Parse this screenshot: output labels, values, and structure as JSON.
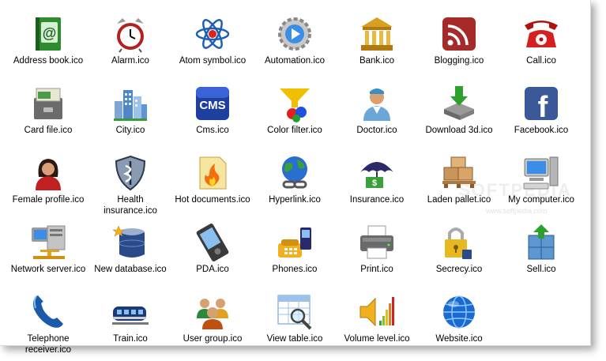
{
  "watermark": "SOFTPEDIA",
  "watermark_url": "www.softpedia.com",
  "icons": [
    {
      "label": "Address book.ico",
      "icon": "address-book-icon"
    },
    {
      "label": "Alarm.ico",
      "icon": "alarm-icon"
    },
    {
      "label": "Atom symbol.ico",
      "icon": "atom-icon"
    },
    {
      "label": "Automation.ico",
      "icon": "automation-icon"
    },
    {
      "label": "Bank.ico",
      "icon": "bank-icon"
    },
    {
      "label": "Blogging.ico",
      "icon": "blogging-icon"
    },
    {
      "label": "Call.ico",
      "icon": "call-icon"
    },
    {
      "label": "Card file.ico",
      "icon": "card-file-icon"
    },
    {
      "label": "City.ico",
      "icon": "city-icon"
    },
    {
      "label": "Cms.ico",
      "icon": "cms-icon",
      "text": "CMS"
    },
    {
      "label": "Color filter.ico",
      "icon": "color-filter-icon"
    },
    {
      "label": "Doctor.ico",
      "icon": "doctor-icon"
    },
    {
      "label": "Download 3d.ico",
      "icon": "download-3d-icon"
    },
    {
      "label": "Facebook.ico",
      "icon": "facebook-icon",
      "text": "f"
    },
    {
      "label": "Female profile.ico",
      "icon": "female-profile-icon"
    },
    {
      "label": "Health insurance.ico",
      "icon": "health-insurance-icon"
    },
    {
      "label": "Hot documents.ico",
      "icon": "hot-documents-icon"
    },
    {
      "label": "Hyperlink.ico",
      "icon": "hyperlink-icon"
    },
    {
      "label": "Insurance.ico",
      "icon": "insurance-icon"
    },
    {
      "label": "Laden pallet.ico",
      "icon": "laden-pallet-icon"
    },
    {
      "label": "My computer.ico",
      "icon": "my-computer-icon"
    },
    {
      "label": "Network server.ico",
      "icon": "network-server-icon"
    },
    {
      "label": "New database.ico",
      "icon": "new-database-icon"
    },
    {
      "label": "PDA.ico",
      "icon": "pda-icon"
    },
    {
      "label": "Phones.ico",
      "icon": "phones-icon"
    },
    {
      "label": "Print.ico",
      "icon": "print-icon"
    },
    {
      "label": "Secrecy.ico",
      "icon": "secrecy-icon"
    },
    {
      "label": "Sell.ico",
      "icon": "sell-icon"
    },
    {
      "label": "Telephone receiver.ico",
      "icon": "telephone-receiver-icon"
    },
    {
      "label": "Train.ico",
      "icon": "train-icon"
    },
    {
      "label": "User group.ico",
      "icon": "user-group-icon"
    },
    {
      "label": "View table.ico",
      "icon": "view-table-icon"
    },
    {
      "label": "Volume level.ico",
      "icon": "volume-level-icon"
    },
    {
      "label": "Website.ico",
      "icon": "website-icon"
    }
  ]
}
